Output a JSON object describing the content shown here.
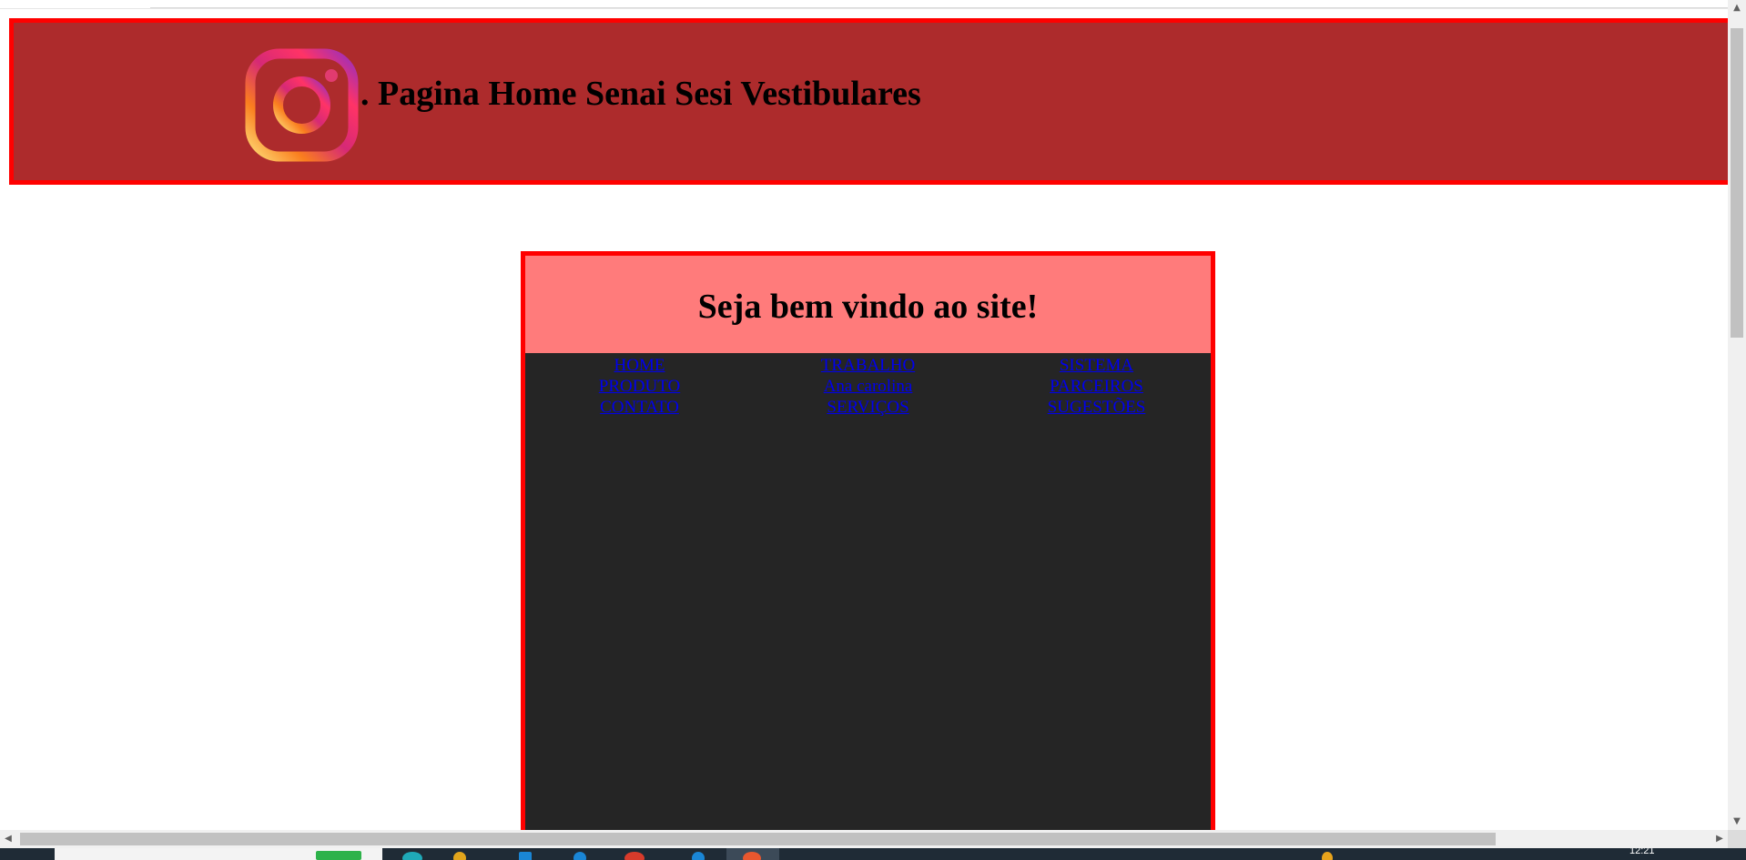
{
  "header": {
    "logo_icon": "instagram-logo-icon",
    "title": ". Pagina Home Senai Sesi Vestibulares",
    "background": "#ad2b2c",
    "border_color": "#ff0000"
  },
  "welcome": {
    "title": "Seja bem vindo ao site!",
    "header_background": "#ff7b7b",
    "body_background": "#252525"
  },
  "menu": {
    "columns": [
      {
        "links": [
          "HOME",
          "PRODUTO",
          "CONTATO"
        ]
      },
      {
        "links": [
          "TRABALHO",
          "Ana carolina",
          "SERVIÇOS"
        ]
      },
      {
        "links": [
          "SISTEMA",
          "PARCEIROS",
          "SUGESTÕES"
        ]
      }
    ],
    "link_color": "#0000ee"
  },
  "taskbar": {
    "clock": "12:21"
  }
}
